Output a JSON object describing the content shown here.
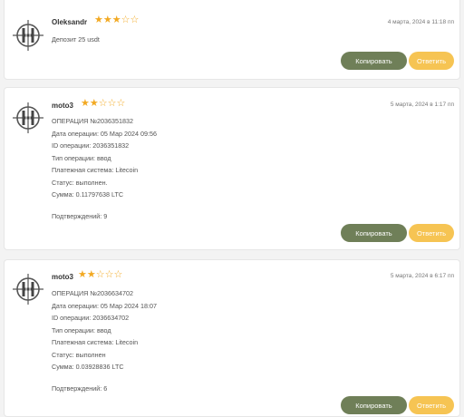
{
  "comments": [
    {
      "author": "Oleksandr",
      "rating": 3,
      "date": "4 марта, 2024 в 11:18 пп",
      "lines": [
        "Депозит 25 usdt"
      ],
      "confirmations": "",
      "copy_label": "Копировать",
      "reply_label": "Ответить"
    },
    {
      "author": "moto3",
      "rating": 2,
      "date": "5 марта, 2024 в 1:17 пп",
      "lines": [
        "ОПЕРАЦИЯ №2036351832",
        "Дата операции: 05 Мар 2024 09:56",
        "ID операции: 2036351832",
        "Тип операции: ввод",
        "Платежная система: Litecoin",
        "Статус: выполнен.",
        "Сумма: 0.11797638 LTC"
      ],
      "confirmations": "Подтверждений: 9",
      "copy_label": "Копировать",
      "reply_label": "Ответить"
    },
    {
      "author": "moto3",
      "rating": 2,
      "date": "5 марта, 2024 в 6:17 пп",
      "lines": [
        "ОПЕРАЦИЯ №2036634702",
        "Дата операции: 05 Мар 2024 18:07",
        "ID операции: 2036634702",
        "Тип операции: ввод",
        "Платежная система: Litecoin",
        "Статус: выполнен",
        "Сумма: 0.03928836 LTC"
      ],
      "confirmations": "Подтверждений: 6",
      "copy_label": "Копировать",
      "reply_label": "Ответить"
    }
  ],
  "colors": {
    "star": "#f2a922",
    "copy_button": "#6f7f58",
    "reply_button": "#f6c453"
  },
  "icons": {
    "avatar": "crosshair-logo-icon",
    "star": "star-icon"
  }
}
